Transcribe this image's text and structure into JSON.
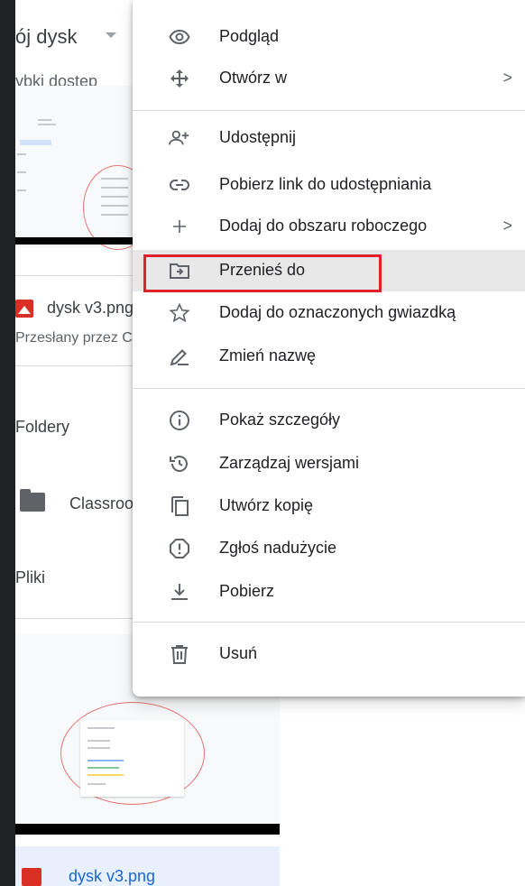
{
  "background": {
    "title": "ój dysk",
    "quick_access": "ybki dostęp",
    "card1": {
      "name": "dysk v3.png",
      "subtitle": "Przesłany przez C"
    },
    "folders_label": "Foldery",
    "folder_name": "Classroo",
    "files_label": "Pliki",
    "card2": {
      "name": "dysk v3.png"
    }
  },
  "menu": {
    "items": [
      {
        "label": "Podgląd",
        "icon": "eye-icon"
      },
      {
        "label": "Otwórz w",
        "icon": "move-arrows-icon",
        "submenu": true
      },
      {
        "label": "Udostępnij",
        "icon": "add-person-icon"
      },
      {
        "label": "Pobierz link do udostępniania",
        "icon": "link-icon"
      },
      {
        "label": "Dodaj do obszaru roboczego",
        "icon": "plus-icon",
        "submenu": true
      },
      {
        "label": "Przenieś do",
        "icon": "move-to-folder-icon",
        "highlighted": true
      },
      {
        "label": "Dodaj do oznaczonych gwiazdką",
        "icon": "star-icon"
      },
      {
        "label": "Zmień nazwę",
        "icon": "pencil-icon"
      },
      {
        "label": "Pokaż szczegóły",
        "icon": "info-icon"
      },
      {
        "label": "Zarządzaj wersjami",
        "icon": "history-icon"
      },
      {
        "label": "Utwórz kopię",
        "icon": "copy-icon"
      },
      {
        "label": "Zgłoś nadużycie",
        "icon": "report-icon"
      },
      {
        "label": "Pobierz",
        "icon": "download-icon"
      },
      {
        "label": "Usuń",
        "icon": "trash-icon"
      }
    ],
    "submenu_glyph": ">"
  },
  "colors": {
    "highlight_border": "#e0202a",
    "selected_bg": "#e8f0fe",
    "icon_gray": "#5f6368"
  }
}
